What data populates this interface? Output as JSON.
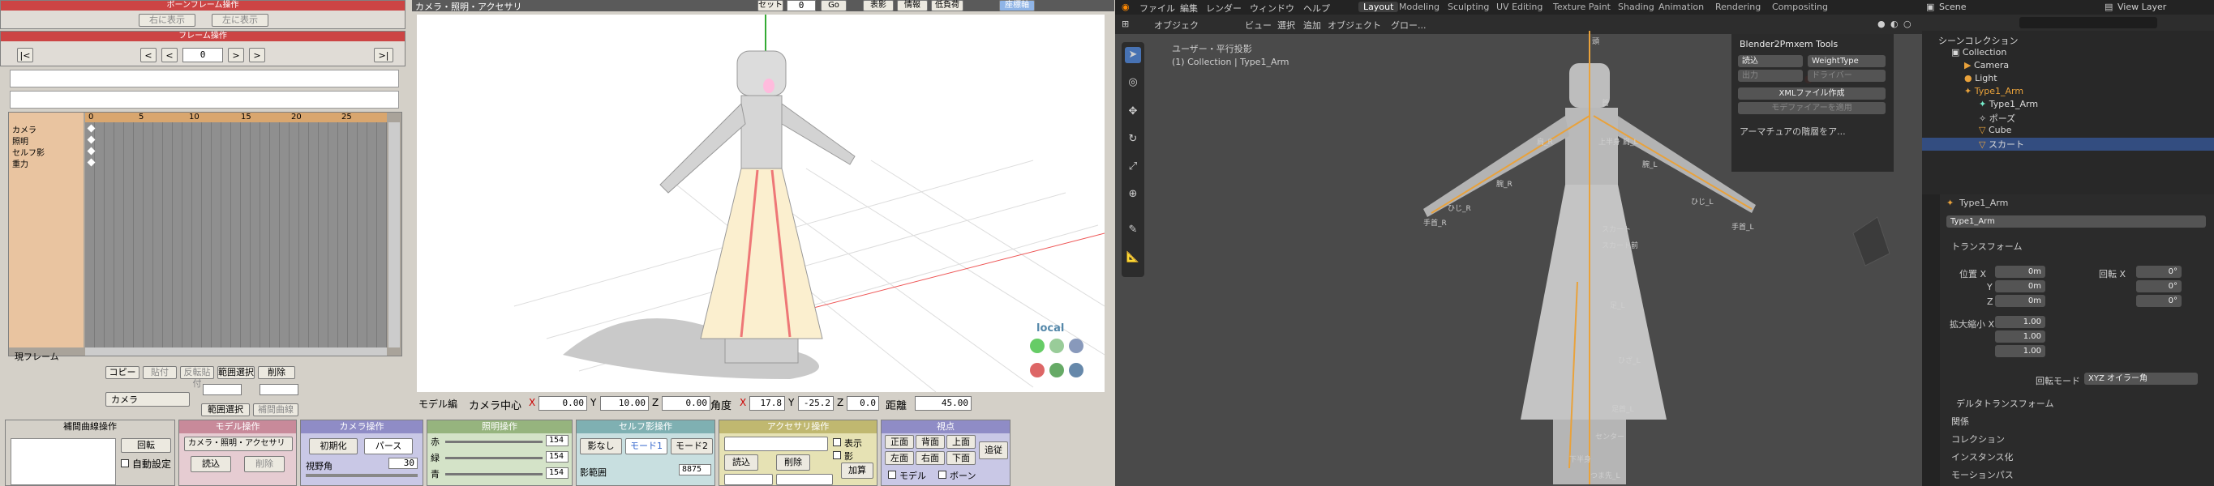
{
  "mmd": {
    "bone_frame": {
      "title": "ボーンフレーム操作",
      "copy_btn": "右に表示",
      "paste_btn": "左に表示"
    },
    "frame_op": {
      "title": "フレーム操作",
      "first": "|<",
      "prev_key": "<",
      "prev": "<",
      "frame": "0",
      "next": ">",
      "next_key": ">",
      "last": ">|"
    },
    "timeline": {
      "ticks": [
        "0",
        "5",
        "10",
        "15",
        "20",
        "25"
      ],
      "tracks": [
        "カメラ",
        "照明",
        "セルフ影",
        "重力"
      ],
      "now_label": "現フレーム"
    },
    "key_ops": {
      "copy": "コピー",
      "paste": "貼付",
      "reverse": "反転貼付",
      "select": "範囲選択",
      "delete": "削除",
      "range": "範囲選択",
      "interp": "補間曲線"
    },
    "camera_select": "カメラ",
    "viewport": {
      "title": "カメラ・照明・アクセサリ",
      "axis_label": "local",
      "gizmo": [
        "x",
        "y",
        "z"
      ]
    },
    "topbar": {
      "set": "セット",
      "set_val": "0",
      "go": "Go",
      "shadow": "表影",
      "info": "情報",
      "lowfps": "低負荷",
      "playmode": "座標軸"
    },
    "camera_bar": {
      "mode": "モデル編",
      "center": "カメラ中心",
      "x": "0.00",
      "y": "10.00",
      "z": "0.00",
      "angle": "角度",
      "ax": "17.8",
      "ay": "-25.2",
      "az": "0.0",
      "dist": "距離",
      "dist_val": "45.00"
    },
    "bottom": {
      "interp_title": "補間曲線操作",
      "rotate": "回転",
      "auto": "自動設定",
      "model_title": "モデル操作",
      "model_select": "カメラ・照明・アクセサリ",
      "load": "読込",
      "delete": "削除",
      "camera_title": "カメラ操作",
      "init": "初期化",
      "persp": "パース",
      "fov": "視野角",
      "fov_val": "30",
      "light_title": "照明操作",
      "r": "赤",
      "g": "緑",
      "b": "青",
      "rv": "154",
      "gv": "154",
      "bv": "154",
      "self_title": "セルフ影操作",
      "noshadow": "影なし",
      "mode1": "モード1",
      "mode2": "モード2",
      "range": "影範囲",
      "range_val": "8875",
      "acc_title": "アクセサリ操作",
      "show": "表示",
      "shadow": "影",
      "acc_load": "読込",
      "acc_del": "削除",
      "add": "加算",
      "view_title": "視点",
      "front": "正面",
      "back": "背面",
      "top": "上面",
      "left": "左面",
      "right": "右面",
      "bottom": "下面",
      "track": "追従",
      "model": "モデル",
      "bone": "ボーン"
    }
  },
  "blender": {
    "menus": [
      "ファイル",
      "編集",
      "レンダー",
      "ウィンドウ",
      "ヘルプ"
    ],
    "workspaces": [
      "Layout",
      "Modeling",
      "Sculpting",
      "UV Editing",
      "Texture Paint",
      "Shading",
      "Animation",
      "Rendering",
      "Compositing"
    ],
    "scene": "Scene",
    "view_layer": "View Layer",
    "vp_menus": [
      "オブジェク",
      "ビュー",
      "選択",
      "追加",
      "オブジェクト"
    ],
    "transform_global": "グロー...",
    "vp_info": [
      "ユーザー・平行投影",
      "(1) Collection | Type1_Arm"
    ],
    "npanel": {
      "title": "Blender2Pmxem Tools",
      "import": "読込",
      "weight": "WeightType",
      "export": "出力",
      "driver": "ドライバー",
      "xml": "XMLファイル作成",
      "bone_names": "モデファイアーを適用",
      "arm": "アーマチュアの階層をア..."
    },
    "bones": [
      "頭",
      "首",
      "上半身",
      "肩_L",
      "腕_L",
      "ひじ_L",
      "手首_L",
      "肩_R",
      "腕_R",
      "ひじ_R",
      "手首_R",
      "スカート",
      "スカート前",
      "足_L",
      "ひざ_L",
      "足首_L",
      "つま先_L",
      "下半身",
      "センター"
    ],
    "outliner": {
      "root": "シーンコレクション",
      "items": [
        "Collection",
        "Camera",
        "Light",
        "Type1_Arm",
        "Type1_Arm",
        "ポーズ",
        "Cube",
        "スカート"
      ]
    },
    "props": {
      "object": "Type1_Arm",
      "obj_field": "Type1_Arm",
      "transform": "トランスフォーム",
      "loc": "位置 X",
      "y": "Y",
      "z": "Z",
      "rot": "回転 X",
      "scale": "拡大縮小 X",
      "loc_x": "0m",
      "loc_y": "0m",
      "loc_z": "0m",
      "rot_x": "0°",
      "rot_y": "0°",
      "rot_z": "0°",
      "sx": "1.00",
      "sy": "1.00",
      "sz": "1.00",
      "rot_mode": "回転モード",
      "rot_mode_val": "XYZ オイラー角",
      "delta": "デルタトランスフォーム",
      "relations": "関係",
      "collection": "コレクション",
      "instancing": "インスタンス化",
      "motion": "モーションパス"
    }
  }
}
